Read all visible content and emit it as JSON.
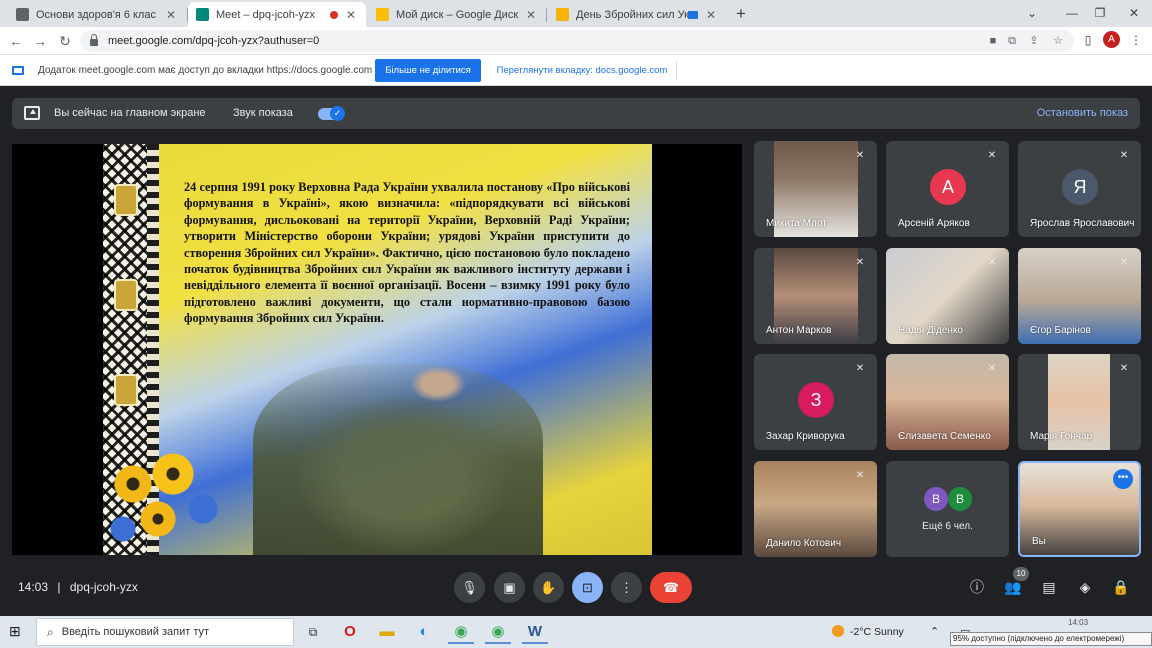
{
  "browser": {
    "tabs": [
      {
        "title": "Основи здоров'я 6 клас",
        "favicon_color": "#5f6368",
        "active": false,
        "indicator": ""
      },
      {
        "title": "Meet – dpq-jcoh-yzx",
        "favicon_color": "#00897b",
        "active": true,
        "indicator": "recording"
      },
      {
        "title": "Мой диск – Google Диск",
        "favicon_color": "#fbbc04",
        "active": false,
        "indicator": ""
      },
      {
        "title": "День Збройних сил Україн",
        "favicon_color": "#f4b400",
        "active": false,
        "indicator": "casting"
      }
    ],
    "url": "meet.google.com/dpq-jcoh-yzx?authuser=0",
    "profile_initial": "A",
    "profile_color": "#c5221f"
  },
  "infobar": {
    "message": "Додаток meet.google.com має доступ до вкладки https://docs.google.com",
    "stop_sharing_label": "Більше не ділитися",
    "switch_tab_label": "Переглянути вкладку: docs.google.com"
  },
  "meet": {
    "present_bar": {
      "status": "Вы сейчас на главном экране",
      "sound_label": "Звук показа",
      "sound_on": true,
      "stop_label": "Остановить показ"
    },
    "slide": {
      "text": "24 серпня 1991 року Верховна Рада України ухвалила постанову «Про військові формування в Україні», якою визначила: «підпорядкувати всі військові формування, дисльоковані на території України, Верховній Раді України; утворити Міністерство оборони України; урядові України приступити до створення Збройних сил України». Фактично, цією постановою було покладено початок будівництва Збройних сил України як важливого інституту держави і невіддільного елемента її воєнної організації. Восени – взимку 1991 року було підготовлено важливі документи, що стали нормативно-правовою базою формування Збройних сил України."
    },
    "participants": [
      {
        "name": "Микита Млот",
        "type": "video",
        "muted": true
      },
      {
        "name": "Арсеній Аряков",
        "type": "avatar",
        "initial": "А",
        "color": "#e8384f",
        "muted": true
      },
      {
        "name": "Ярослав Ярославович",
        "type": "avatar",
        "initial": "Я",
        "color": "#4a5a6a",
        "muted": true
      },
      {
        "name": "Антон Марков",
        "type": "video",
        "muted": true
      },
      {
        "name": "Надія Діденко",
        "type": "video",
        "muted": true
      },
      {
        "name": "Єгор Барінов",
        "type": "video",
        "muted": true
      },
      {
        "name": "Захар Криворука",
        "type": "avatar",
        "initial": "З",
        "color": "#d81b60",
        "muted": true
      },
      {
        "name": "Єлизавета Семенко",
        "type": "video",
        "muted": true
      },
      {
        "name": "Марія Гончар",
        "type": "video",
        "muted": true
      },
      {
        "name": "Данило Котович",
        "type": "video",
        "muted": true
      },
      {
        "name": "Ещё 6 чел.",
        "type": "more",
        "initials": [
          "В",
          "В"
        ],
        "colors": [
          "#7e57c2",
          "#1e8e3e"
        ]
      },
      {
        "name": "Вы",
        "type": "self"
      }
    ],
    "controls": {
      "time": "14:03",
      "separator": "|",
      "meeting_code": "dpq-jcoh-yzx",
      "participants_count": "10"
    }
  },
  "taskbar": {
    "search_placeholder": "Введіть пошуковий запит тут",
    "weather": "-2°C  Sunny",
    "tooltip": "95% доступно (підключено до електромережі)",
    "clock_time": "14:03"
  }
}
